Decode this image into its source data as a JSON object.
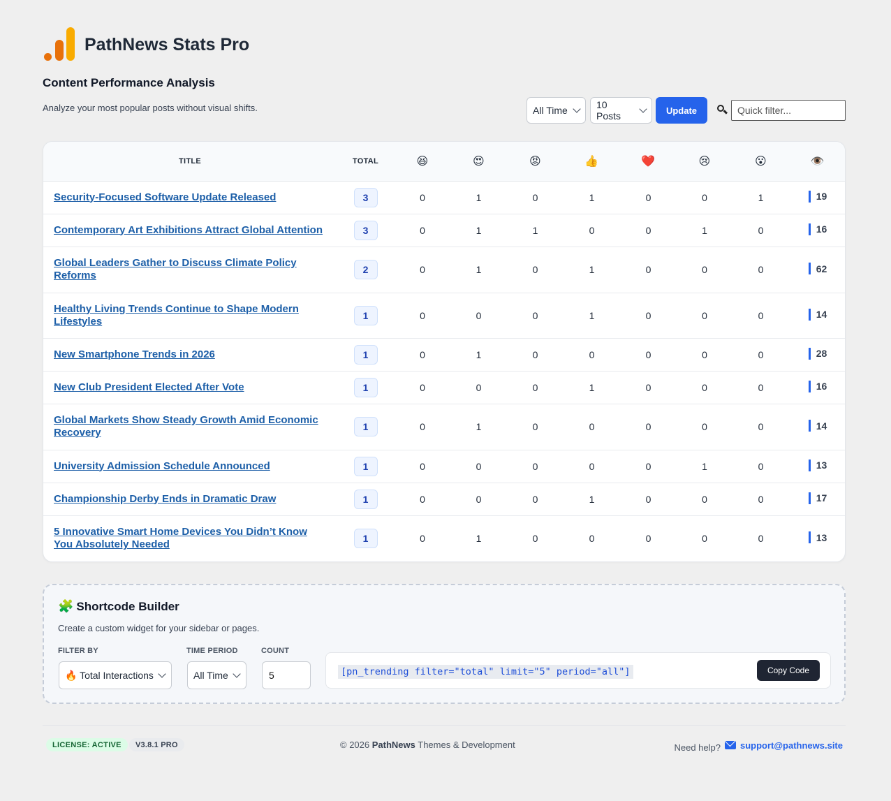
{
  "brand": {
    "name": "PathNews Stats Pro"
  },
  "analysis": {
    "title": "Content Performance Analysis",
    "subtitle": "Analyze your most popular posts without visual shifts."
  },
  "controls": {
    "time_value": "All Time",
    "posts_value": "10 Posts",
    "update_label": "Update",
    "filter_placeholder": "Quick filter..."
  },
  "table": {
    "headers": {
      "title": "TITLE",
      "total": "TOTAL",
      "reactions": [
        "😆",
        "😍",
        "😡",
        "👍",
        "❤️",
        "😢",
        "😮"
      ],
      "views": "👁️"
    },
    "rows": [
      {
        "title": "Security-Focused Software Update Released",
        "total": "3",
        "reactions": [
          "0",
          "1",
          "0",
          "1",
          "0",
          "0",
          "1"
        ],
        "views": "19"
      },
      {
        "title": "Contemporary Art Exhibitions Attract Global Attention",
        "total": "3",
        "reactions": [
          "0",
          "1",
          "1",
          "0",
          "0",
          "1",
          "0"
        ],
        "views": "16"
      },
      {
        "title": "Global Leaders Gather to Discuss Climate Policy Reforms",
        "total": "2",
        "reactions": [
          "0",
          "1",
          "0",
          "1",
          "0",
          "0",
          "0"
        ],
        "views": "62"
      },
      {
        "title": "Healthy Living Trends Continue to Shape Modern Lifestyles",
        "total": "1",
        "reactions": [
          "0",
          "0",
          "0",
          "1",
          "0",
          "0",
          "0"
        ],
        "views": "14"
      },
      {
        "title": "New Smartphone Trends in 2026",
        "total": "1",
        "reactions": [
          "0",
          "1",
          "0",
          "0",
          "0",
          "0",
          "0"
        ],
        "views": "28"
      },
      {
        "title": "New Club President Elected After Vote",
        "total": "1",
        "reactions": [
          "0",
          "0",
          "0",
          "1",
          "0",
          "0",
          "0"
        ],
        "views": "16"
      },
      {
        "title": "Global Markets Show Steady Growth Amid Economic Recovery",
        "total": "1",
        "reactions": [
          "0",
          "1",
          "0",
          "0",
          "0",
          "0",
          "0"
        ],
        "views": "14"
      },
      {
        "title": "University Admission Schedule Announced",
        "total": "1",
        "reactions": [
          "0",
          "0",
          "0",
          "0",
          "0",
          "1",
          "0"
        ],
        "views": "13"
      },
      {
        "title": "Championship Derby Ends in Dramatic Draw",
        "total": "1",
        "reactions": [
          "0",
          "0",
          "0",
          "1",
          "0",
          "0",
          "0"
        ],
        "views": "17"
      },
      {
        "title": "5 Innovative Smart Home Devices You Didn’t Know You Absolutely Needed",
        "total": "1",
        "reactions": [
          "0",
          "1",
          "0",
          "0",
          "0",
          "0",
          "0"
        ],
        "views": "13"
      }
    ]
  },
  "builder": {
    "icon": "🧩",
    "title": "Shortcode Builder",
    "subtitle": "Create a custom widget for your sidebar or pages.",
    "filter_label": "FILTER BY",
    "filter_value": "🔥 Total Interactions",
    "period_label": "TIME PERIOD",
    "period_value": "All Time",
    "count_label": "COUNT",
    "count_value": "5",
    "shortcode": "[pn_trending filter=\"total\" limit=\"5\" period=\"all\"]",
    "copy_label": "Copy Code"
  },
  "footer": {
    "license": "LICENSE: ACTIVE",
    "version": "V3.8.1 PRO",
    "copyright_prefix": "© 2026 ",
    "copyright_brand": "PathNews",
    "copyright_suffix": " Themes & Development",
    "help_text": "Need help?",
    "support_email": "support@pathnews.site"
  },
  "colors": {
    "accent": "#2563eb",
    "link": "#1d5fa8",
    "logo_orange": "#e8710a",
    "logo_yellow": "#f9ab00",
    "license_green": "#166534"
  },
  "icons": {
    "logo": "bar-chart-logo-icon",
    "search": "search-icon",
    "mail": "mail-icon",
    "puzzle": "puzzle-icon"
  }
}
